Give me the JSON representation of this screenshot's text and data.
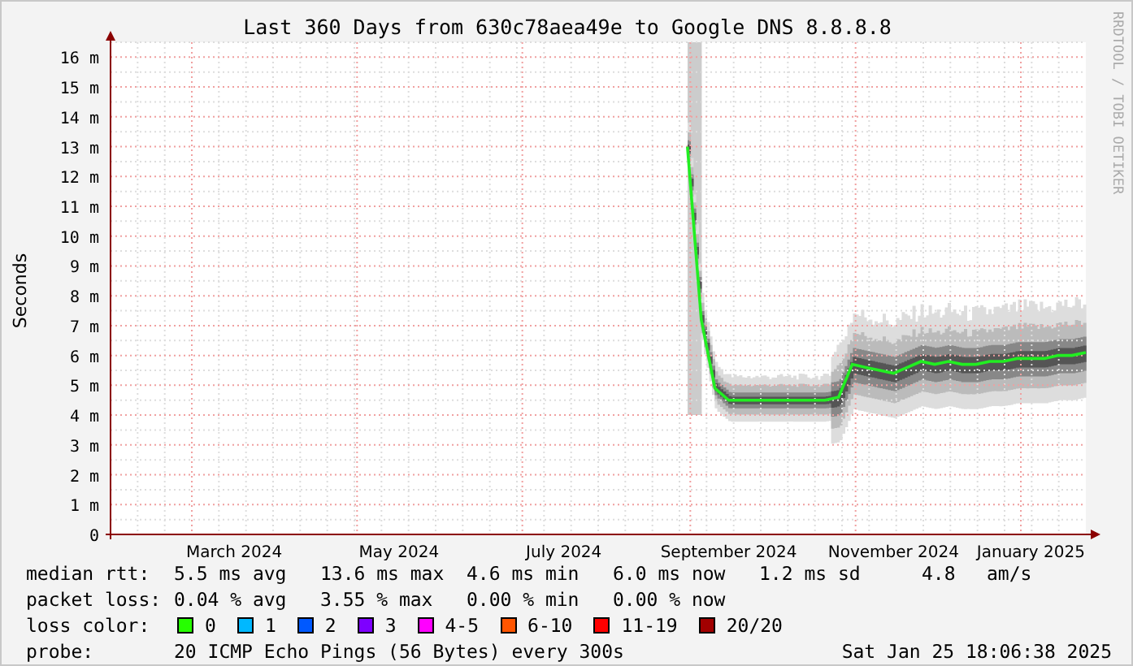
{
  "chart": {
    "chart_data": {
      "type": "line",
      "grid": true,
      "title": "Last 360 Days from 630c78aea49e to Google DNS 8.8.8.8",
      "ylabel": "Seconds",
      "ylim": [
        0,
        16.5
      ],
      "categories": [
        null,
        null,
        null,
        null,
        null,
        null,
        null,
        null,
        null,
        "March 2024",
        null,
        null,
        null,
        null,
        null,
        null,
        null,
        null,
        null,
        null,
        null,
        "May 2024",
        null,
        null,
        null,
        null,
        null,
        null,
        null,
        null,
        null,
        null,
        null,
        "July 2024",
        null,
        null,
        null,
        null,
        null,
        null,
        null,
        null,
        null,
        null,
        null,
        "September 2024",
        null,
        null,
        null,
        null,
        null,
        null,
        null,
        null,
        null,
        null,
        null,
        "November 2024",
        null,
        null,
        null,
        null,
        null,
        null,
        null,
        null,
        null,
        "January 2025",
        null,
        null,
        null,
        null
      ],
      "yticks": [
        {
          "value": 0,
          "label": "0"
        },
        {
          "value": 1,
          "label": "1 m"
        },
        {
          "value": 2,
          "label": "2 m"
        },
        {
          "value": 3,
          "label": "3 m"
        },
        {
          "value": 4,
          "label": "4 m"
        },
        {
          "value": 5,
          "label": "5 m"
        },
        {
          "value": 6,
          "label": "6 m"
        },
        {
          "value": 7,
          "label": "7 m"
        },
        {
          "value": 8,
          "label": "8 m"
        },
        {
          "value": 9,
          "label": "9 m"
        },
        {
          "value": 10,
          "label": "10 m"
        },
        {
          "value": 11,
          "label": "11 m"
        },
        {
          "value": 12,
          "label": "12 m"
        },
        {
          "value": 13,
          "label": "13 m"
        },
        {
          "value": 14,
          "label": "14 m"
        },
        {
          "value": 15,
          "label": "15 m"
        },
        {
          "value": 16,
          "label": "16 m"
        }
      ],
      "series": [
        {
          "color": "#22ee22",
          "values": [
            null,
            null,
            null,
            null,
            null,
            null,
            null,
            null,
            null,
            null,
            null,
            null,
            null,
            null,
            null,
            null,
            null,
            null,
            null,
            null,
            null,
            null,
            null,
            null,
            null,
            null,
            null,
            null,
            null,
            null,
            null,
            null,
            null,
            null,
            null,
            null,
            null,
            null,
            null,
            null,
            null,
            null,
            13.0,
            7.2,
            4.9,
            4.5,
            4.5,
            4.5,
            4.5,
            4.5,
            4.5,
            4.5,
            4.5,
            4.6,
            5.7,
            5.6,
            5.5,
            5.4,
            5.6,
            5.8,
            5.7,
            5.8,
            5.7,
            5.7,
            5.8,
            5.8,
            5.9,
            5.9,
            5.9,
            6.0,
            6.0,
            6.1
          ]
        }
      ]
    },
    "credit": "RRDTOOL / TOBI OETIKER"
  },
  "stats": [
    {
      "label": "median rtt:",
      "items": [
        "5.5 ms avg",
        "13.6 ms max",
        "4.6 ms min",
        "6.0 ms now",
        "1.2 ms sd",
        "4.8",
        "am/s"
      ]
    },
    {
      "label": "packet loss:",
      "items": [
        "0.04 % avg",
        "3.55 % max",
        "0.00 % min",
        "0.00 % now"
      ]
    }
  ],
  "loss_legend": {
    "label": "loss color:",
    "items": [
      {
        "label": "0",
        "color": "#26ff00"
      },
      {
        "label": "1",
        "color": "#00b8ff"
      },
      {
        "label": "2",
        "color": "#0059ff"
      },
      {
        "label": "3",
        "color": "#7e00ff"
      },
      {
        "label": "4-5",
        "color": "#ff00ff"
      },
      {
        "label": "6-10",
        "color": "#ff5500"
      },
      {
        "label": "11-19",
        "color": "#ff0000"
      },
      {
        "label": "20/20",
        "color": "#a10000"
      }
    ]
  },
  "probe": {
    "label": "probe:",
    "text": "20 ICMP Echo Pings (56 Bytes) every 300s",
    "timestamp": "Sat Jan 25 18:06:38 2025"
  }
}
